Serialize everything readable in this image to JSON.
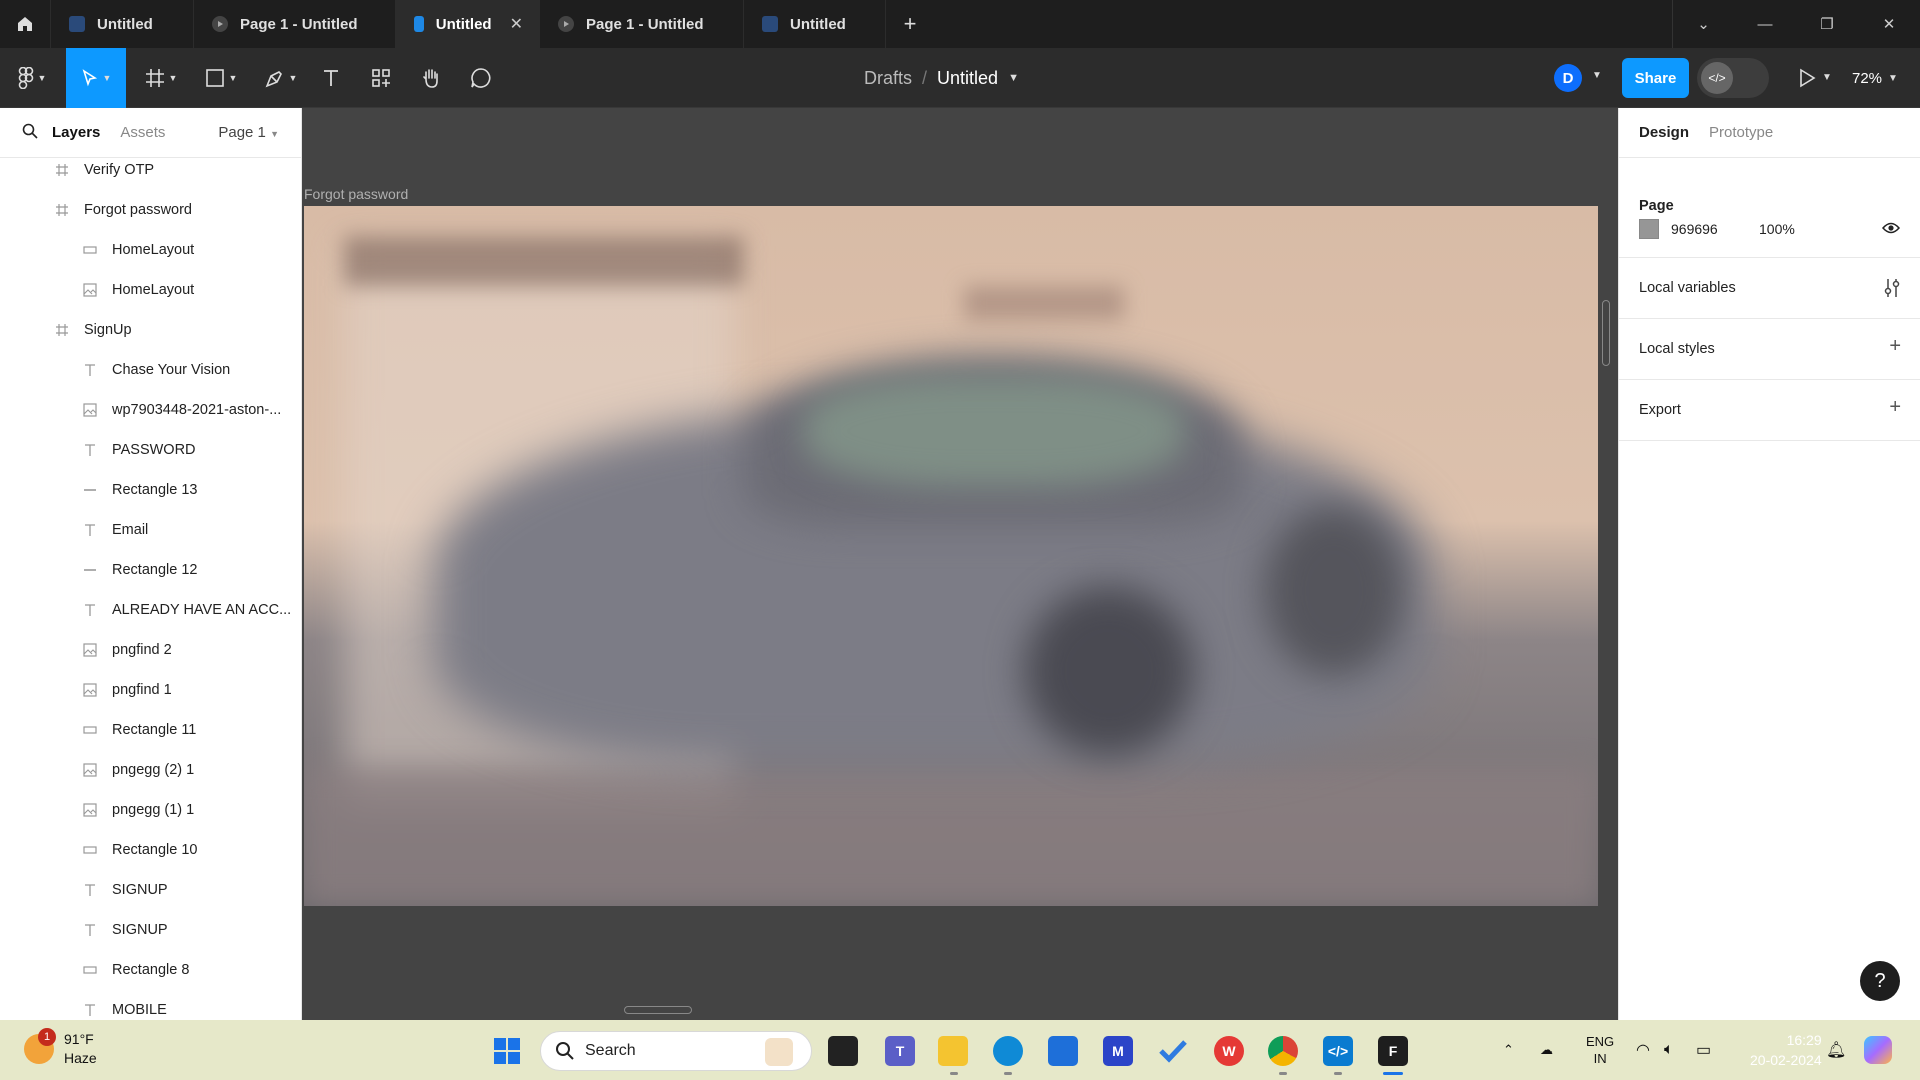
{
  "tabs": [
    {
      "label": "Untitled",
      "active": false,
      "icon": "figma-file-icon"
    },
    {
      "label": "Page 1 - Untitled",
      "active": false,
      "icon": "prototype-play-icon"
    },
    {
      "label": "Untitled",
      "active": true,
      "icon": "figma-file-icon"
    },
    {
      "label": "Page 1 - Untitled",
      "active": false,
      "icon": "prototype-play-icon"
    },
    {
      "label": "Untitled",
      "active": false,
      "icon": "figma-file-icon"
    }
  ],
  "breadcrumb": {
    "folder": "Drafts",
    "separator": "/",
    "file": "Untitled"
  },
  "toolbar": {
    "avatar_initial": "D",
    "share_label": "Share",
    "zoom": "72%"
  },
  "left_panel": {
    "tab_layers": "Layers",
    "tab_assets": "Assets",
    "page_selector": "Page 1",
    "layers": [
      {
        "name": "Verify OTP",
        "type": "frame",
        "indent": 1
      },
      {
        "name": "Forgot password",
        "type": "frame",
        "indent": 1
      },
      {
        "name": "HomeLayout",
        "type": "rectangle",
        "indent": 2
      },
      {
        "name": "HomeLayout",
        "type": "image",
        "indent": 2
      },
      {
        "name": "SignUp",
        "type": "frame",
        "indent": 1
      },
      {
        "name": "Chase Your Vision",
        "type": "text",
        "indent": 2
      },
      {
        "name": "wp7903448-2021-aston-...",
        "type": "image",
        "indent": 2
      },
      {
        "name": "PASSWORD",
        "type": "text",
        "indent": 2
      },
      {
        "name": "Rectangle 13",
        "type": "line",
        "indent": 2
      },
      {
        "name": "Email",
        "type": "text",
        "indent": 2
      },
      {
        "name": "Rectangle 12",
        "type": "line",
        "indent": 2
      },
      {
        "name": "ALREADY HAVE AN ACC...",
        "type": "text",
        "indent": 2
      },
      {
        "name": "pngfind 2",
        "type": "image",
        "indent": 2
      },
      {
        "name": "pngfind 1",
        "type": "image",
        "indent": 2
      },
      {
        "name": "Rectangle 11",
        "type": "rectangle",
        "indent": 2
      },
      {
        "name": "pngegg (2) 1",
        "type": "image",
        "indent": 2
      },
      {
        "name": "pngegg (1) 1",
        "type": "image",
        "indent": 2
      },
      {
        "name": "Rectangle 10",
        "type": "rectangle",
        "indent": 2
      },
      {
        "name": "SIGNUP",
        "type": "text",
        "indent": 2
      },
      {
        "name": "SIGNUP",
        "type": "text",
        "indent": 2
      },
      {
        "name": "Rectangle 8",
        "type": "rectangle",
        "indent": 2
      },
      {
        "name": "MOBILE",
        "type": "text",
        "indent": 2
      }
    ]
  },
  "canvas": {
    "frame_label": "Forgot password",
    "background": "#444444"
  },
  "right_panel": {
    "tab_design": "Design",
    "tab_prototype": "Prototype",
    "page_title": "Page",
    "page_color_hex": "969696",
    "page_opacity": "100%",
    "local_variables": "Local variables",
    "local_styles": "Local styles",
    "export": "Export",
    "help": "?"
  },
  "taskbar": {
    "weather_temp": "91°F",
    "weather_desc": "Haze",
    "weather_badge": "1",
    "search_placeholder": "Search",
    "lang_line1": "ENG",
    "lang_line2": "IN",
    "time": "16:29",
    "date": "20-02-2024"
  },
  "colors": {
    "accent": "#0d99ff",
    "taskbar": "#e6e8c9",
    "canvas": "#444444"
  }
}
